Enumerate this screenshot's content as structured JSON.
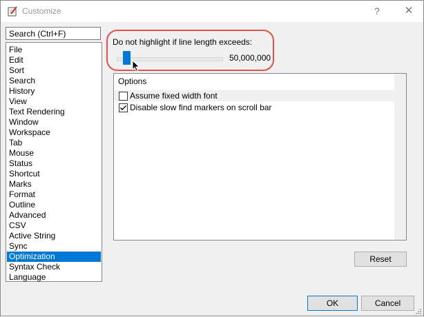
{
  "window": {
    "title": "Customize",
    "help_glyph": "?",
    "close_glyph": "✕",
    "app_icon": "notepad-pencil-icon"
  },
  "search": {
    "placeholder": "Search (Ctrl+F)"
  },
  "categories": [
    {
      "label": "File"
    },
    {
      "label": "Edit"
    },
    {
      "label": "Sort"
    },
    {
      "label": "Search"
    },
    {
      "label": "History"
    },
    {
      "label": "View"
    },
    {
      "label": "Text Rendering"
    },
    {
      "label": "Window"
    },
    {
      "label": "Workspace"
    },
    {
      "label": "Tab"
    },
    {
      "label": "Mouse"
    },
    {
      "label": "Status"
    },
    {
      "label": "Shortcut"
    },
    {
      "label": "Marks"
    },
    {
      "label": "Format"
    },
    {
      "label": "Outline"
    },
    {
      "label": "Advanced"
    },
    {
      "label": "CSV"
    },
    {
      "label": "Active String"
    },
    {
      "label": "Sync"
    },
    {
      "label": "Optimization",
      "selected": true
    },
    {
      "label": "Syntax Check"
    },
    {
      "label": "Language"
    }
  ],
  "slider": {
    "label": "Do not highlight if line length exceeds:",
    "value_text": "50,000,000"
  },
  "options": {
    "header": "Options",
    "items": [
      {
        "label": "Assume fixed width font",
        "checked": false
      },
      {
        "label": "Disable slow find markers on scroll bar",
        "checked": true
      }
    ]
  },
  "buttons": {
    "reset": "Reset",
    "ok": "OK",
    "cancel": "Cancel"
  },
  "colors": {
    "accent": "#0078d7",
    "annotation": "#e0524a"
  }
}
